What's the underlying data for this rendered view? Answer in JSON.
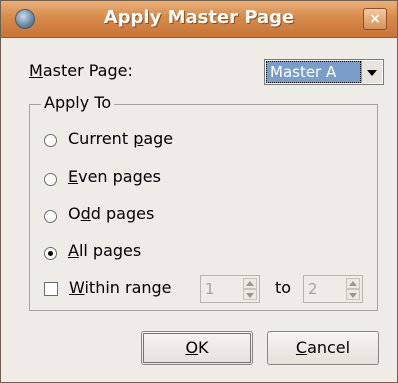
{
  "window": {
    "title": "Apply Master Page",
    "close_glyph": "×",
    "icon": "app-globe-icon"
  },
  "master_page": {
    "label_pre": "",
    "label_mn": "M",
    "label_post": "aster Page:",
    "selected": "Master A"
  },
  "apply_to": {
    "title": "Apply To",
    "current": {
      "pre": "Current ",
      "mn": "p",
      "post": "age"
    },
    "even": {
      "pre": "",
      "mn": "E",
      "post": "ven pages"
    },
    "odd": {
      "pre": "O",
      "mn": "d",
      "post": "d pages"
    },
    "all": {
      "pre": "",
      "mn": "A",
      "post": "ll pages"
    },
    "selected": "All pages",
    "range": {
      "label_pre": "",
      "label_mn": "W",
      "label_post": "ithin range",
      "from": "1",
      "to_label": "to",
      "to": "2",
      "checked": false
    }
  },
  "buttons": {
    "ok": {
      "pre": "",
      "mn": "O",
      "post": "K"
    },
    "cancel": {
      "pre": "",
      "mn": "C",
      "post": "ancel"
    }
  }
}
